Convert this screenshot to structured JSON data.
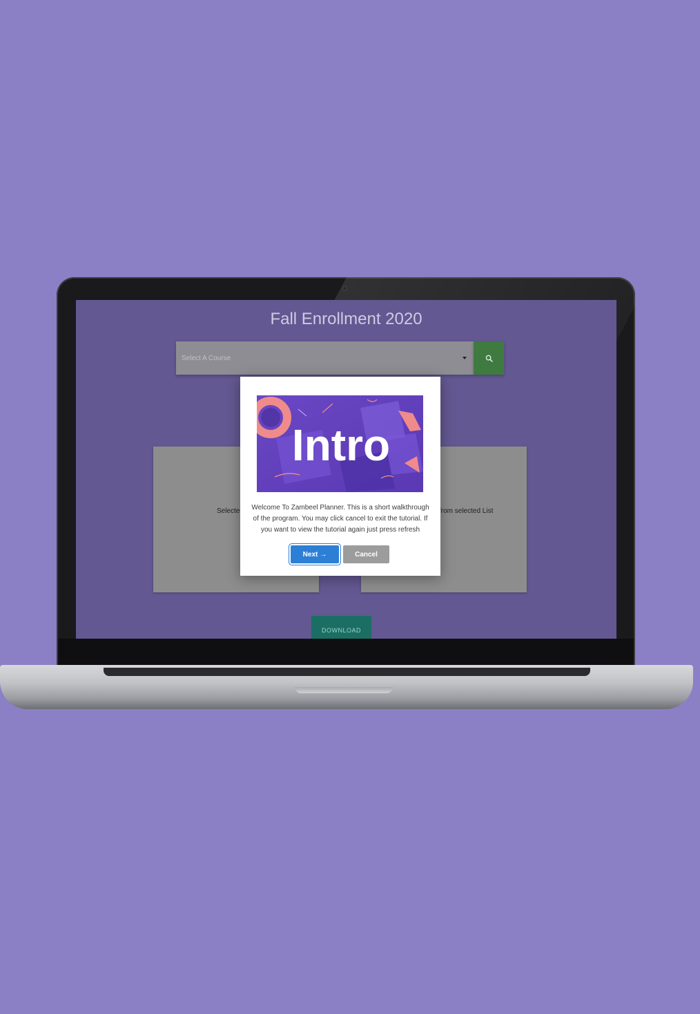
{
  "app": {
    "title": "Fall Enrollment 2020",
    "course_select": {
      "placeholder": "Select A Course"
    },
    "search": {
      "icon": "search-icon"
    },
    "panels": {
      "left_label": "Selected",
      "right_label": "from selected List"
    },
    "download_label": "DOWNLOAD"
  },
  "modal": {
    "image_text": "Intro",
    "message": "Welcome To Zambeel Planner. This is a short walkthrough of the program. You may click cancel to exit the tutorial. If you want to view the tutorial again just press refresh",
    "next_label": "Next",
    "next_icon": "arrow-right-icon",
    "next_arrow": "→",
    "cancel_label": "Cancel"
  },
  "colors": {
    "background": "#8b80c6",
    "screen": "#635891",
    "search_button": "#3f7a41",
    "download_button": "#1b6e63",
    "next_button": "#2d7fd6",
    "cancel_button": "#9c9c9c"
  }
}
